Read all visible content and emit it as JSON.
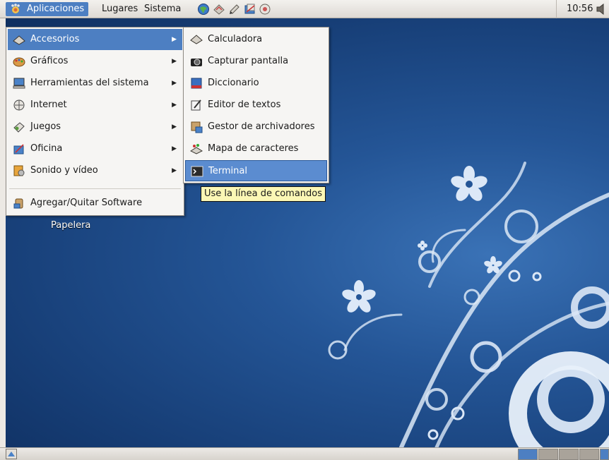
{
  "top_panel": {
    "applications": "Aplicaciones",
    "places": "Lugares",
    "system": "Sistema",
    "launchers": [
      "web-browser-icon",
      "mail-client-icon",
      "text-editor-icon",
      "office-icon",
      "help-icon"
    ],
    "clock": "10:56"
  },
  "desktop": {
    "trash_label": "Papelera"
  },
  "main_menu": {
    "items": [
      {
        "label": "Accesorios",
        "icon": "accessories-icon",
        "submenu": true,
        "selected": true
      },
      {
        "label": "Gráficos",
        "icon": "graphics-icon",
        "submenu": true
      },
      {
        "label": "Herramientas del sistema",
        "icon": "system-tools-icon",
        "submenu": true
      },
      {
        "label": "Internet",
        "icon": "internet-icon",
        "submenu": true
      },
      {
        "label": "Juegos",
        "icon": "games-icon",
        "submenu": true
      },
      {
        "label": "Oficina",
        "icon": "office-icon",
        "submenu": true
      },
      {
        "label": "Sonido y vídeo",
        "icon": "sound-video-icon",
        "submenu": true
      }
    ],
    "extra_item": "Agregar/Quitar Software"
  },
  "sub_menu": {
    "items": [
      {
        "label": "Calculadora",
        "icon": "calculator-icon"
      },
      {
        "label": "Capturar pantalla",
        "icon": "camera-icon"
      },
      {
        "label": "Diccionario",
        "icon": "dictionary-icon"
      },
      {
        "label": "Editor de textos",
        "icon": "text-editor-icon"
      },
      {
        "label": "Gestor de archivadores",
        "icon": "archive-manager-icon"
      },
      {
        "label": "Mapa de caracteres",
        "icon": "character-map-icon"
      },
      {
        "label": "Terminal",
        "icon": "terminal-icon",
        "highlighted": true
      }
    ]
  },
  "tooltip": "Use la línea de comandos",
  "colors": {
    "selection": "#4d7fc2",
    "desktop": "#245596",
    "tooltip_bg": "#fbf7b5"
  }
}
